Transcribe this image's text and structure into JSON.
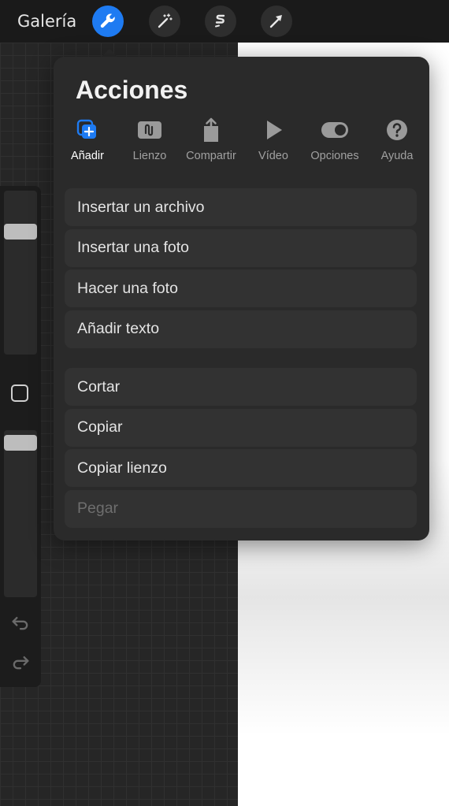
{
  "topbar": {
    "gallery_label": "Galería",
    "tools": [
      {
        "name": "actions-wrench-icon",
        "active": true
      },
      {
        "name": "adjustments-wand-icon",
        "active": false
      },
      {
        "name": "selection-s-icon",
        "active": false
      },
      {
        "name": "transform-arrow-icon",
        "active": false
      }
    ]
  },
  "panel": {
    "title": "Acciones",
    "tabs": [
      {
        "label": "Añadir",
        "icon": "add-icon",
        "active": true
      },
      {
        "label": "Lienzo",
        "icon": "canvas-icon",
        "active": false
      },
      {
        "label": "Compartir",
        "icon": "share-icon",
        "active": false
      },
      {
        "label": "Vídeo",
        "icon": "play-icon",
        "active": false
      },
      {
        "label": "Opciones",
        "icon": "toggle-icon",
        "active": false
      },
      {
        "label": "Ayuda",
        "icon": "help-icon",
        "active": false
      }
    ],
    "group1": [
      {
        "label": "Insertar un archivo",
        "enabled": true
      },
      {
        "label": "Insertar una foto",
        "enabled": true
      },
      {
        "label": "Hacer una foto",
        "enabled": true
      },
      {
        "label": "Añadir texto",
        "enabled": true
      }
    ],
    "group2": [
      {
        "label": "Cortar",
        "enabled": true
      },
      {
        "label": "Copiar",
        "enabled": true
      },
      {
        "label": "Copiar lienzo",
        "enabled": true
      },
      {
        "label": "Pegar",
        "enabled": false
      }
    ]
  },
  "colors": {
    "accent": "#1e7bf2",
    "panel_bg": "#2a2a2a",
    "item_bg": "#323232"
  }
}
